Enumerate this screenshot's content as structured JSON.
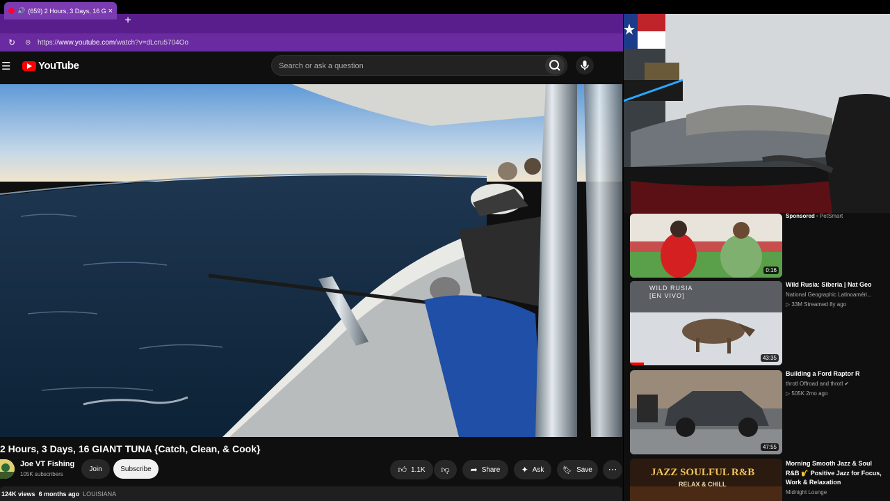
{
  "browser": {
    "tab_title": "(659) 2 Hours, 3 Days, 16 GIANT TUNA {Catch, Clean, & Cook}",
    "new_tab": "+",
    "url_prefix": "https://",
    "url_host": "www.youtube.com",
    "url_path": "/watch?v=dLcru5704Oo",
    "close": "×"
  },
  "youtube": {
    "logo_text": "YouTube",
    "search_placeholder": "Search or ask a question"
  },
  "video": {
    "title": "2 Hours, 3 Days, 16 GIANT TUNA {Catch, Clean, & Cook}",
    "channel": "Joe VT Fishing",
    "subscribers": "105K subscribers",
    "join_label": "Join",
    "subscribe_label": "Subscribe",
    "likes": "1.1K",
    "share_label": "Share",
    "ask_label": "Ask",
    "save_label": "Save",
    "views": "124K views",
    "age": "6 months ago",
    "location": "LOUISIANA"
  },
  "related": [
    {
      "title": "",
      "sponsored_label": "Sponsored",
      "advertiser": "PetSmart",
      "duration": "0:16"
    },
    {
      "title": "Wild Rusia: Siberia | Nat Geo",
      "channel": "National Geographic Latinoaméri...",
      "stats": "33M  Streamed 8y ago",
      "duration": "43:35",
      "thumb_text": "WILD RUSIA\n[EN VIVO]"
    },
    {
      "title": "Building a Ford Raptor R",
      "channel": "throtl Offroad and throtl",
      "stats": "505K  2mo ago",
      "duration": "47:55"
    },
    {
      "title": "Morning Smooth Jazz & Soul R&B 🎷 Positive Jazz for Focus, Work & Relaxation",
      "channel": "Midnight Lounge",
      "thumb_text_1": "JAZZ SOULFUL R&B",
      "thumb_text_2": "RELAX & CHILL"
    }
  ]
}
